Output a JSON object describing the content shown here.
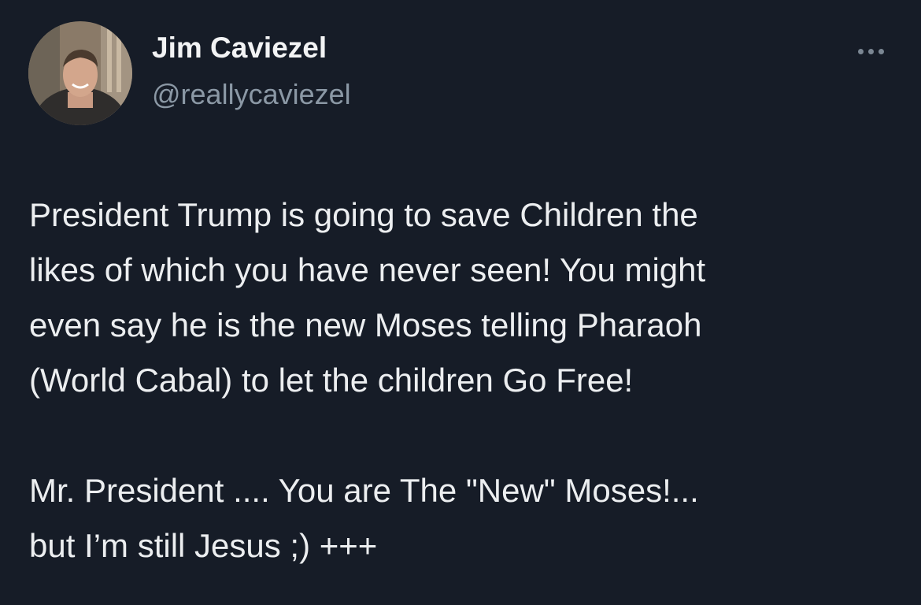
{
  "author": {
    "display_name": "Jim Caviezel",
    "handle": "@reallycaviezel"
  },
  "tweet": {
    "lines_para1": [
      "President Trump is going to save Children the",
      "likes of which you have never seen! You might",
      "even say he is the new Moses telling Pharaoh",
      "(World Cabal) to let the children Go Free!"
    ],
    "lines_para2": [
      "Mr. President .... You are The \"New\" Moses!...",
      "but I’m still Jesus ;) +++"
    ]
  },
  "icons": {
    "more": "more-horizontal-icon"
  },
  "colors": {
    "background": "#161c27",
    "primary_text": "#eceef0",
    "secondary_text": "#8b98a5"
  }
}
